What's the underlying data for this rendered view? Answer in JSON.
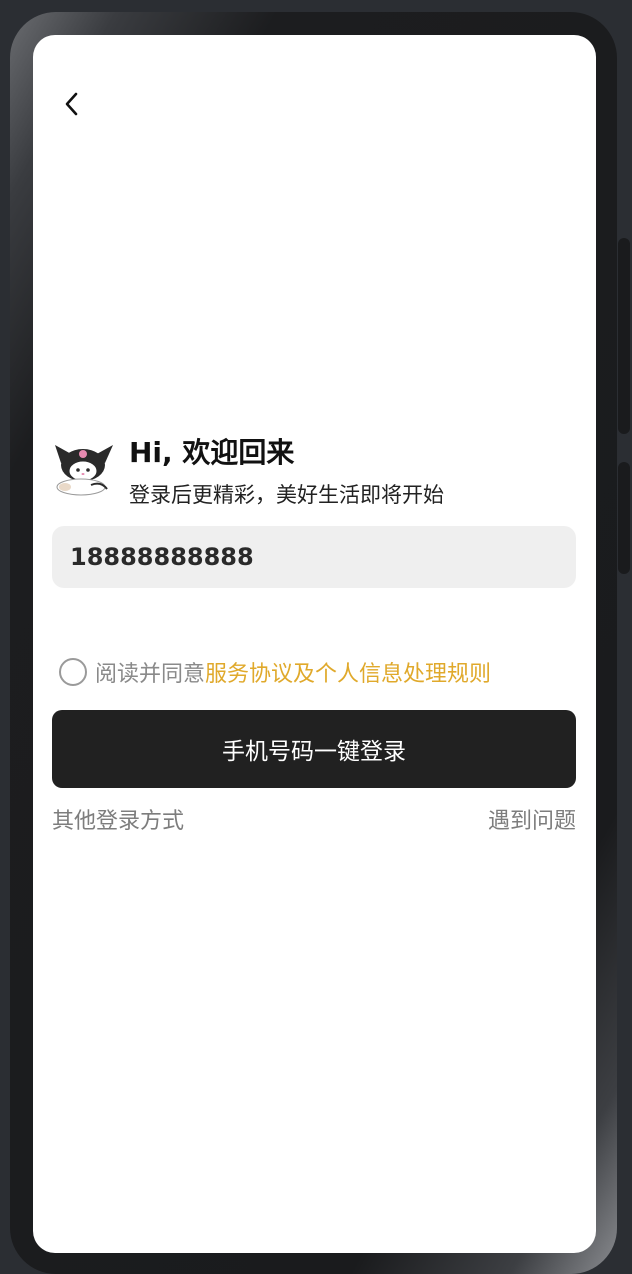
{
  "header": {
    "back_icon": "chevron-left-icon"
  },
  "welcome": {
    "mascot": "kuromi-mascot-avatar",
    "title": "Hi, 欢迎回来",
    "subtitle": "登录后更精彩，美好生活即将开始"
  },
  "phone_field": {
    "value": "18888888888",
    "placeholder": ""
  },
  "agreement": {
    "prefix": "阅读并同意",
    "link": "服务协议及个人信息处理规则",
    "checked": false,
    "link_color": "#e0a92b"
  },
  "login_button": {
    "label": "手机号码一键登录",
    "background": "#212121"
  },
  "footer": {
    "other_login": "其他登录方式",
    "help": "遇到问题"
  }
}
